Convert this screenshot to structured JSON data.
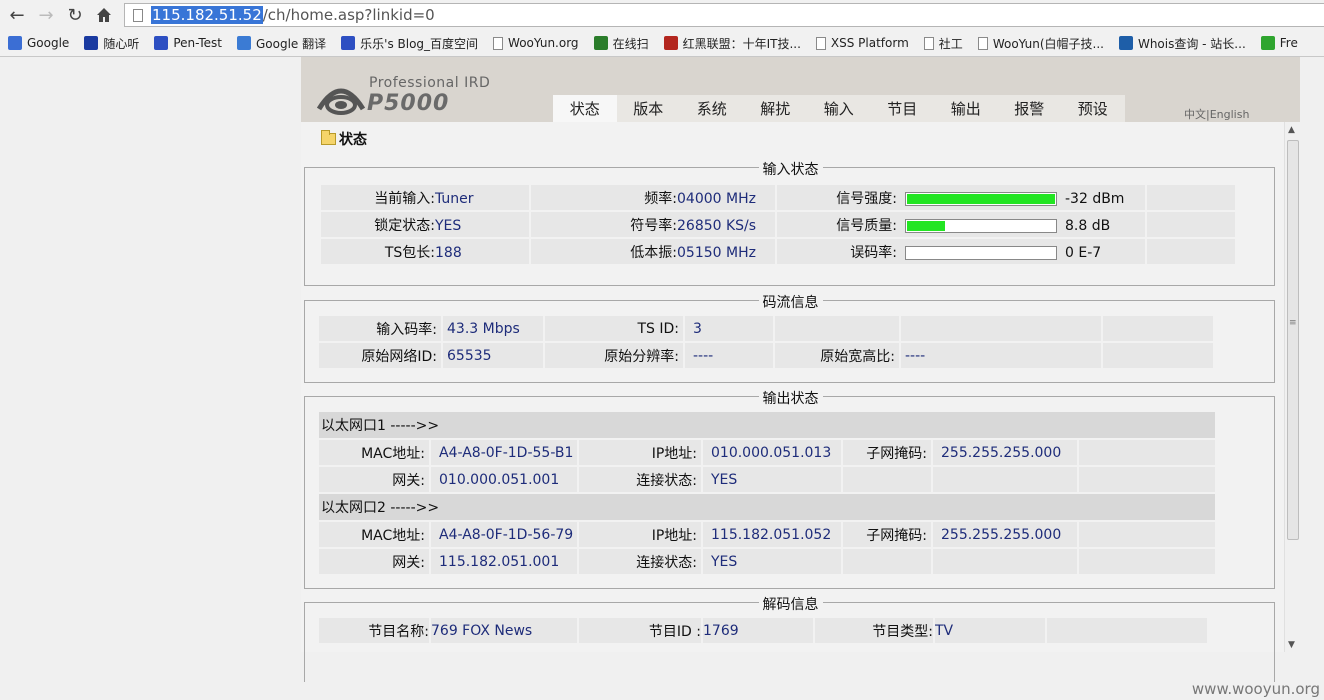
{
  "browser": {
    "url_host": "115.182.51.52",
    "url_path": "/ch/home.asp?linkid=0",
    "bookmarks": [
      {
        "label": "Google",
        "icon": "google-icon",
        "color": "#3b6ed4"
      },
      {
        "label": "随心听",
        "icon": "music-note-icon",
        "color": "#1a3aa0"
      },
      {
        "label": "Pen-Test",
        "icon": "paw-icon",
        "color": "#2d4fc2"
      },
      {
        "label": "Google 翻译",
        "icon": "translate-icon",
        "color": "#3b7bd4"
      },
      {
        "label": "乐乐's Blog_百度空间",
        "icon": "paw-icon",
        "color": "#2d4fc2"
      },
      {
        "label": "WooYun.org",
        "icon": "page-icon",
        "color": ""
      },
      {
        "label": "在线扫",
        "icon": "dots-icon",
        "color": "#2b7d2b"
      },
      {
        "label": "红黑联盟：十年IT技...",
        "icon": "shield-icon",
        "color": "#b3261e"
      },
      {
        "label": "XSS Platform",
        "icon": "page-icon",
        "color": ""
      },
      {
        "label": "社工",
        "icon": "page-icon",
        "color": ""
      },
      {
        "label": "WooYun(白帽子技...",
        "icon": "page-icon",
        "color": ""
      },
      {
        "label": "Whois查询 - 站长...",
        "icon": "whois-icon",
        "color": "#1e5ea8"
      },
      {
        "label": "Fre",
        "icon": "free-icon",
        "color": "#2fa52f"
      }
    ]
  },
  "device": {
    "logo_sub": "Professional  IRD",
    "logo_main": "P5000",
    "tabs": [
      "状态",
      "版本",
      "系统",
      "解扰",
      "输入",
      "节目",
      "输出",
      "报警",
      "预设"
    ],
    "active_tab": 0,
    "lang": "中文|English",
    "section_title": "状态"
  },
  "input_status": {
    "title": "输入状态",
    "rows": [
      {
        "l1": "当前输入:",
        "v1": "Tuner",
        "l2": "频率:",
        "v2": "04000 MHz",
        "l3": "信号强度:",
        "bar": 1.0,
        "v3": "-32 dBm"
      },
      {
        "l1": "锁定状态:",
        "v1": "YES",
        "l2": "符号率:",
        "v2": "26850 KS/s",
        "l3": "信号质量:",
        "bar": 0.26,
        "v3": "8.8 dB"
      },
      {
        "l1": "TS包长:",
        "v1": "188",
        "l2": "低本振:",
        "v2": "05150 MHz",
        "l3": "误码率:",
        "bar": 0.0,
        "v3": "0 E-7"
      }
    ]
  },
  "stream_info": {
    "title": "码流信息",
    "rows": [
      {
        "l1": "输入码率:",
        "v1": "43.3 Mbps",
        "l2": "TS ID:",
        "v2": "3",
        "l3": "",
        "v3": ""
      },
      {
        "l1": "原始网络ID:",
        "v1": "65535",
        "l2": "原始分辨率:",
        "v2": "----",
        "l3": "原始宽高比:",
        "v3": "----"
      }
    ]
  },
  "output_status": {
    "title": "输出状态",
    "ports": [
      {
        "name": "以太网口1 ----->>",
        "mac_l": "MAC地址:",
        "mac": "A4-A8-0F-1D-55-B1",
        "ip_l": "IP地址:",
        "ip": "010.000.051.013",
        "mask_l": "子网掩码:",
        "mask": "255.255.255.000",
        "gw_l": "网关:",
        "gw": "010.000.051.001",
        "link_l": "连接状态:",
        "link": "YES"
      },
      {
        "name": "以太网口2 ----->>",
        "mac_l": "MAC地址:",
        "mac": "A4-A8-0F-1D-56-79",
        "ip_l": "IP地址:",
        "ip": "115.182.051.052",
        "mask_l": "子网掩码:",
        "mask": "255.255.255.000",
        "gw_l": "网关:",
        "gw": "115.182.051.001",
        "link_l": "连接状态:",
        "link": "YES"
      }
    ]
  },
  "decode_info": {
    "title": "解码信息",
    "row": {
      "l1": "节目名称:",
      "v1": "769 FOX News",
      "l2": "节目ID :",
      "v2": "1769",
      "l3": "节目类型:",
      "v3": "TV"
    }
  },
  "watermark": "www.wooyun.org"
}
